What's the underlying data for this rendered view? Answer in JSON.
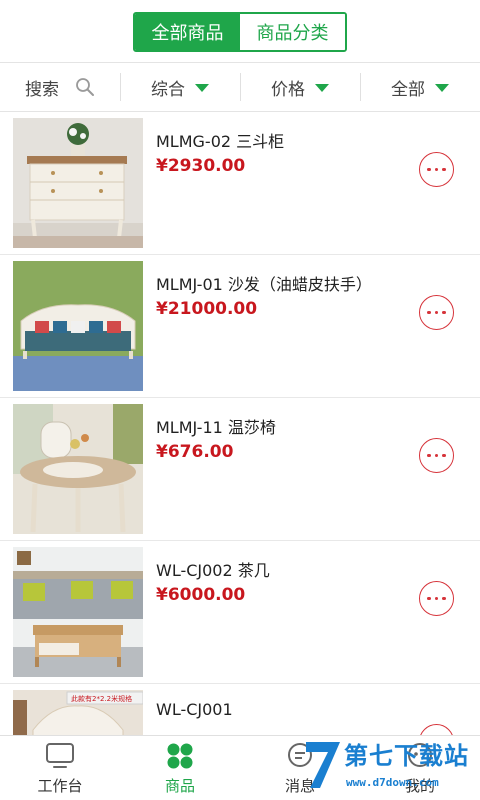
{
  "top_tabs": [
    {
      "label": "全部商品",
      "active": true
    },
    {
      "label": "商品分类",
      "active": false
    }
  ],
  "filters": {
    "search": {
      "label": "搜索",
      "icon": "search-icon"
    },
    "sort": {
      "label": "综合",
      "icon": "caret-down-icon"
    },
    "price": {
      "label": "价格",
      "icon": "caret-down-icon"
    },
    "range": {
      "label": "全部",
      "icon": "caret-down-icon"
    }
  },
  "products": [
    {
      "name": "MLMG-02  三斗柜",
      "price": "¥2930.00",
      "image": "dresser-image"
    },
    {
      "name": "MLMJ-01  沙发（油蜡皮扶手）",
      "price": "¥21000.00",
      "image": "sofa-image"
    },
    {
      "name": "MLMJ-11  温莎椅",
      "price": "¥676.00",
      "image": "windsor-chair-image"
    },
    {
      "name": "WL-CJ002  茶几",
      "price": "¥6000.00",
      "image": "coffee-table-image"
    },
    {
      "name": "WL-CJ001",
      "price": "",
      "image": "bedroom-image",
      "image_banner": "此款有2*2.2米规格"
    }
  ],
  "bottom_tabs": [
    {
      "label": "工作台",
      "icon": "monitor-icon",
      "active": false
    },
    {
      "label": "商品",
      "icon": "grid-icon",
      "active": true
    },
    {
      "label": "消息",
      "icon": "message-icon",
      "active": false
    },
    {
      "label": "我的",
      "icon": "profile-icon",
      "active": false
    }
  ],
  "watermark": {
    "text": "第七下载站",
    "url": "www.d7down.com"
  },
  "colors": {
    "accent": "#1fa64a",
    "price": "#c8171e",
    "more_button": "#d6333a",
    "watermark": "#1a7fd0"
  }
}
